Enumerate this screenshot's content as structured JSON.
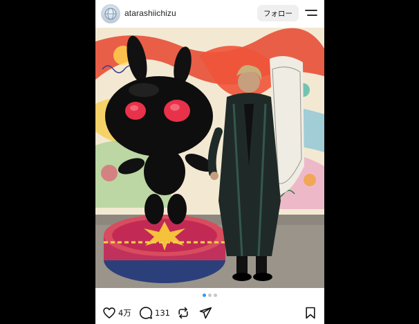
{
  "post": {
    "username": "atarashiichizu",
    "follow_label": "フォロー",
    "like_count": "4万",
    "comment_count": "131",
    "carousel": {
      "total": 3,
      "active": 1
    },
    "colors": {
      "accent_dot": "#3897f0",
      "inactive_dot": "#c7c7c7",
      "follow_bg": "#efefef"
    }
  },
  "icons": {
    "menu": "menu-lines-icon",
    "like": "heart-icon",
    "comment": "comment-bubble-icon",
    "repost": "repost-arrows-icon",
    "share": "send-plane-icon",
    "save": "bookmark-icon"
  }
}
